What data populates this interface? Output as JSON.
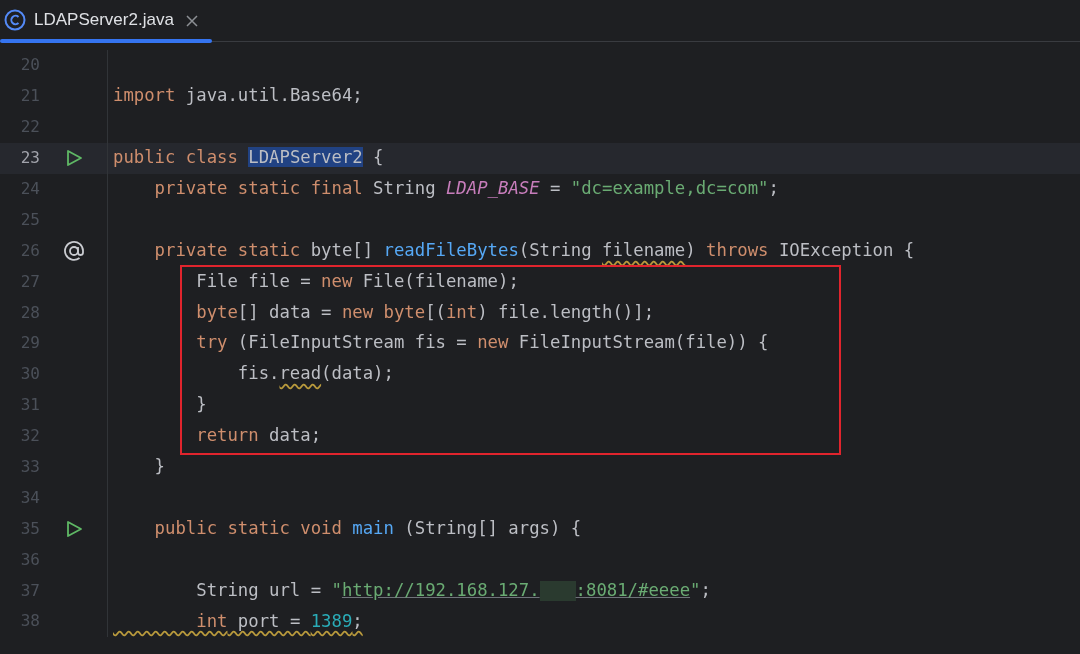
{
  "tab": {
    "label": "LDAPServer2.java",
    "selected": true
  },
  "lines": [
    {
      "number": "20"
    },
    {
      "number": "21",
      "tokens": [
        {
          "kind": "keyword",
          "text": "import"
        },
        {
          "kind": "plain",
          "text": " java.util.Base64;"
        }
      ]
    },
    {
      "number": "22"
    },
    {
      "number": "23",
      "current": true,
      "run_icon": true,
      "tokens": [
        {
          "kind": "keyword",
          "text": "public class "
        },
        {
          "kind": "plain",
          "text": "LDAPServer2",
          "selected": true
        },
        {
          "kind": "plain",
          "text": " {"
        }
      ]
    },
    {
      "number": "24",
      "tokens": [
        {
          "kind": "keyword",
          "text": "    private static final "
        },
        {
          "kind": "plain",
          "text": "String "
        },
        {
          "kind": "field",
          "text": "LDAP_BASE"
        },
        {
          "kind": "plain",
          "text": " = "
        },
        {
          "kind": "string",
          "text": "\"dc=example,dc=com\""
        },
        {
          "kind": "plain",
          "text": ";"
        }
      ]
    },
    {
      "number": "25"
    },
    {
      "number": "26",
      "annotation_icon": true,
      "tokens": [
        {
          "kind": "keyword",
          "text": "    private static "
        },
        {
          "kind": "plain",
          "text": "byte[] "
        },
        {
          "kind": "method",
          "text": "readFileBytes"
        },
        {
          "kind": "plain",
          "text": "(String "
        },
        {
          "kind": "plain",
          "text": "filename",
          "warning": true
        },
        {
          "kind": "plain",
          "text": ") "
        },
        {
          "kind": "keyword",
          "text": "throws "
        },
        {
          "kind": "plain",
          "text": "IOException {"
        }
      ]
    },
    {
      "number": "27",
      "boxed": true,
      "tokens": [
        {
          "kind": "plain",
          "text": "        File file = "
        },
        {
          "kind": "keyword",
          "text": "new "
        },
        {
          "kind": "plain",
          "text": "File(filename);"
        }
      ]
    },
    {
      "number": "28",
      "boxed": true,
      "tokens": [
        {
          "kind": "keyword",
          "text": "        byte"
        },
        {
          "kind": "plain",
          "text": "[] data = "
        },
        {
          "kind": "keyword",
          "text": "new byte"
        },
        {
          "kind": "plain",
          "text": "[("
        },
        {
          "kind": "keyword",
          "text": "int"
        },
        {
          "kind": "plain",
          "text": ") file.length()];"
        }
      ]
    },
    {
      "number": "29",
      "boxed": true,
      "tokens": [
        {
          "kind": "keyword",
          "text": "        try "
        },
        {
          "kind": "plain",
          "text": "(FileInputStream fis = "
        },
        {
          "kind": "keyword",
          "text": "new "
        },
        {
          "kind": "plain",
          "text": "FileInputStream(file)) {"
        }
      ]
    },
    {
      "number": "30",
      "boxed": true,
      "tokens": [
        {
          "kind": "plain",
          "text": "            fis."
        },
        {
          "kind": "plain",
          "text": "read",
          "warning": true
        },
        {
          "kind": "plain",
          "text": "(data);"
        }
      ]
    },
    {
      "number": "31",
      "boxed": true,
      "tokens": [
        {
          "kind": "plain",
          "text": "        }"
        }
      ]
    },
    {
      "number": "32",
      "boxed": true,
      "tokens": [
        {
          "kind": "keyword",
          "text": "        return "
        },
        {
          "kind": "plain",
          "text": "data;"
        }
      ]
    },
    {
      "number": "33",
      "tokens": [
        {
          "kind": "plain",
          "text": "    }"
        }
      ]
    },
    {
      "number": "34"
    },
    {
      "number": "35",
      "run_icon": true,
      "tokens": [
        {
          "kind": "keyword",
          "text": "    public static void "
        },
        {
          "kind": "method",
          "text": "main"
        },
        {
          "kind": "plain",
          "text": " (String[] args) {"
        }
      ]
    },
    {
      "number": "36"
    },
    {
      "number": "37",
      "tokens": [
        {
          "kind": "plain",
          "text": "        String url = "
        },
        {
          "kind": "string",
          "text": "\""
        },
        {
          "kind": "link",
          "text": "http://192.168.127."
        },
        {
          "kind": "redacted"
        },
        {
          "kind": "link",
          "text": ":8081/#eeee"
        },
        {
          "kind": "string",
          "text": "\""
        },
        {
          "kind": "plain",
          "text": ";"
        }
      ]
    },
    {
      "number": "38",
      "tokens": [
        {
          "kind": "keyword",
          "text": "        int",
          "warning": true
        },
        {
          "kind": "plain",
          "text": " port = ",
          "warning": true
        },
        {
          "kind": "number",
          "text": "1389",
          "warning": true
        },
        {
          "kind": "plain",
          "text": ";",
          "warning": true
        }
      ]
    }
  ]
}
